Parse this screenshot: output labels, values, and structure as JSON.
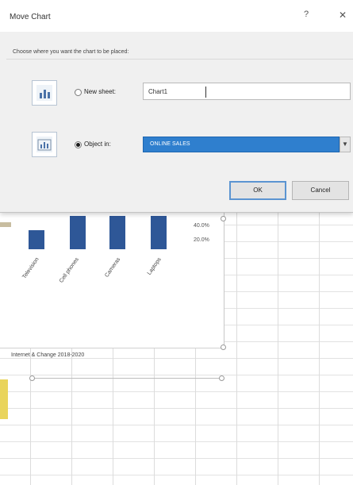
{
  "dialog": {
    "title": "Move Chart",
    "help_label": "?",
    "close_label": "✕",
    "instruction": "Choose where you want the chart to be placed:",
    "new_sheet": {
      "label": "New sheet:",
      "value": "Chart1",
      "checked": false,
      "icon": "new-sheet-chart-icon"
    },
    "object_in": {
      "label": "Object in:",
      "value": "ONLINE SALES",
      "checked": true,
      "icon": "object-in-chart-icon"
    },
    "ok_label": "OK",
    "cancel_label": "Cancel"
  },
  "chart": {
    "axis_labels": [
      "60.0%",
      "40.0%",
      "20.0%"
    ],
    "bar_color": "#2e5797",
    "categories": [
      "Television",
      "Cell phones",
      "Cameras",
      "Laptops"
    ]
  },
  "chart2": {
    "title": "Internet & Change 2018-2020"
  },
  "colors": {
    "accent": "#2f7fce",
    "dialog_bg": "#f0f0f0"
  }
}
